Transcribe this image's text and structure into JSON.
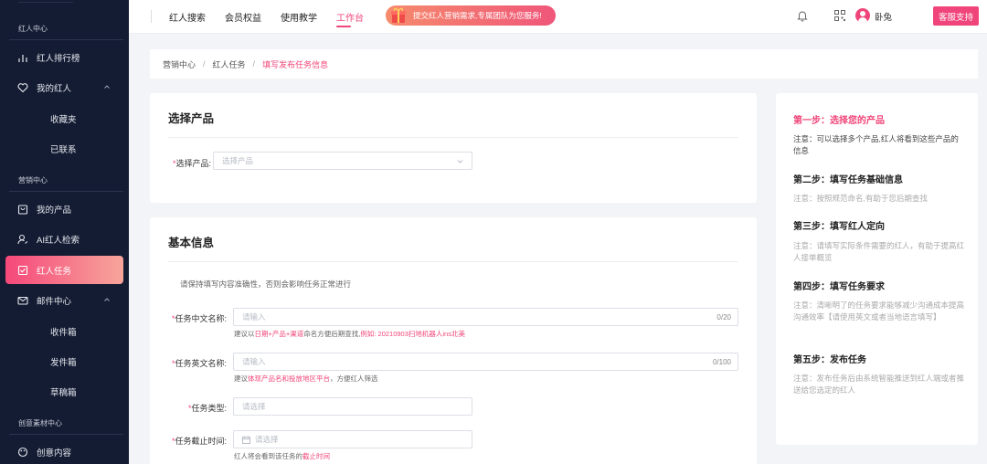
{
  "sidebar": {
    "section_influencer": "红人中心",
    "section_marketing": "营销中心",
    "section_creative": "创意素材中心",
    "items": {
      "ranking": "红人排行榜",
      "my_influencers": "我的红人",
      "favorites": "收藏夹",
      "contacted": "已联系",
      "my_products": "我的产品",
      "ai_search": "AI红人检索",
      "influencer_tasks": "红人任务",
      "mail_center": "邮件中心",
      "inbox": "收件箱",
      "outbox": "发件箱",
      "drafts": "草稿箱",
      "creative_content": "创意内容"
    }
  },
  "topbar": {
    "nav": [
      "红人搜索",
      "会员权益",
      "使用教学",
      "工作台"
    ],
    "active_nav": "工作台",
    "banner_text": "提交红人营销需求,专属团队为您服务!",
    "username": "卧兔",
    "support_button": "客服支持"
  },
  "breadcrumb": [
    "营销中心",
    "红人任务",
    "填写发布任务信息"
  ],
  "product_card": {
    "title": "选择产品",
    "field_label": "选择产品:",
    "placeholder": "选择产品"
  },
  "basic_card": {
    "title": "基本信息",
    "note": "请保持填写内容准确性，否则会影响任务正常进行",
    "cn_name": {
      "label": "任务中文名称:",
      "placeholder": "请输入",
      "count": "0/20",
      "hint_prefix": "建议以",
      "hint_hl1": "日期+产品+渠道",
      "hint_mid": "命名方便后期查找,",
      "hint_hl2": "例如: 20210903扫地机器人ins北美"
    },
    "en_name": {
      "label": "任务英文名称:",
      "placeholder": "请输入",
      "count": "0/100",
      "hint_prefix": "建议",
      "hint_hl": "体现产品名和投放地区平台",
      "hint_suffix": "，方便红人筛选"
    },
    "task_type": {
      "label": "任务类型:",
      "placeholder": "请选择"
    },
    "deadline": {
      "label": "任务截止时间:",
      "placeholder": "请选择",
      "hint_prefix": "红人将会看到该任务的",
      "hint_hl": "截止时间"
    }
  },
  "steps": [
    {
      "title": "第一步：选择您的产品",
      "desc": "注意：可以选择多个产品,红人将看到这些产品的信息"
    },
    {
      "title": "第二步：填写任务基础信息",
      "desc": "注意：按照规范命名,有助于您后期查找"
    },
    {
      "title": "第三步：填写红人定向",
      "desc": "注意：请填写实际条件需要的红人，有助于提高红人接单概览"
    },
    {
      "title": "第四步：填写任务要求",
      "desc": "注意：清晰明了的任务要求能够减少沟通成本提高沟通效率【请使用英文或者当地语言填写】"
    },
    {
      "title": "第五步：发布任务",
      "desc": "注意：发布任务后由系统智能推送到红人端或者推送给您选定的红人"
    }
  ],
  "colors": {
    "accent": "#f0457a",
    "sidebar_bg": "#131c33"
  }
}
